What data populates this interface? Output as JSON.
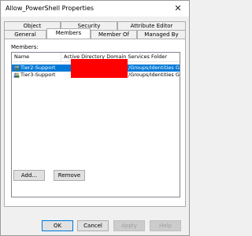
{
  "window": {
    "title": "Allow_PowerShell Properties",
    "close_glyph": "✕"
  },
  "tabs_row1": [
    "Object",
    "Security",
    "Attribute Editor"
  ],
  "tabs_row2": [
    "General",
    "Members",
    "Member Of",
    "Managed By"
  ],
  "active_tab": "Members",
  "members": {
    "label": "Members:",
    "columns": [
      "Name",
      "Active Directory Domain Services Folder"
    ],
    "rows": [
      {
        "name": "Tier2-Support",
        "folder": "/Groups/Identities Grou...",
        "selected": true,
        "icon": "group-icon"
      },
      {
        "name": "Tier3-Support",
        "folder": "/Groups/Identities Grou...",
        "selected": false,
        "icon": "group-icon"
      }
    ],
    "redaction_color": "#fe0000"
  },
  "buttons": {
    "add": "Add...",
    "remove": "Remove"
  },
  "footer": {
    "ok": "OK",
    "cancel": "Cancel",
    "apply": "Apply",
    "help": "Help"
  },
  "colors": {
    "selection": "#0078d7",
    "dialog_bg": "#f0f0f0"
  }
}
